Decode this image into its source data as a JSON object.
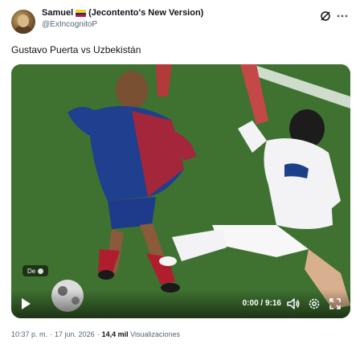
{
  "author": {
    "display_name": "Samuel",
    "display_name_suffix": "(Jecontento's New Version)",
    "handle": "@ExIncognitoP",
    "flag_icon": "colombia-flag-icon"
  },
  "tweet": {
    "text": "Gustavo Puerta vs Uzbekistán"
  },
  "video": {
    "badge_label": "De",
    "time": "0:00 / 9:16",
    "progress": 0,
    "icons": [
      "play-icon",
      "volume-icon",
      "settings-icon",
      "fullscreen-icon"
    ]
  },
  "meta": {
    "time": "10:37 p. m.",
    "date": "17 jun. 2026",
    "views_count": "14,4 mil",
    "views_label": "Visualizaciones"
  },
  "colors": {
    "text_primary": "#0f1419",
    "text_secondary": "#536471"
  }
}
